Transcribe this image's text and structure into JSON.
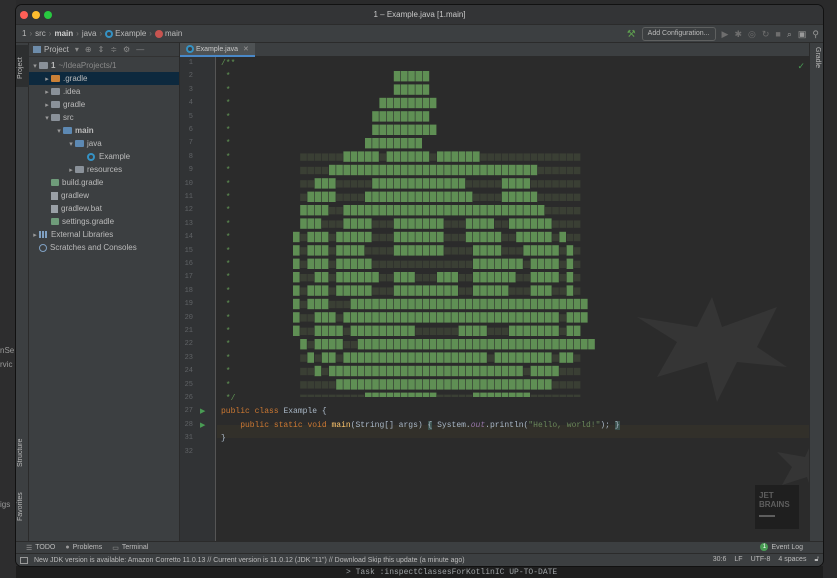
{
  "window": {
    "title": "1 – Example.java [1.main]"
  },
  "navbar": {
    "crumbs": [
      "1",
      "src",
      "main",
      "java",
      "Example",
      "main"
    ],
    "add_configuration": "Add Configuration..."
  },
  "left_strip": {
    "project": "Project",
    "structure": "Structure",
    "favorites": "Favorites"
  },
  "right_strip": {
    "gradle": "Gradle"
  },
  "project_panel": {
    "header": "Project",
    "root_name": "1",
    "root_path": "~/IdeaProjects/1",
    "items": [
      {
        "label": ".gradle",
        "icon": "folder-orange-icon"
      },
      {
        "label": ".idea",
        "icon": "folder-icon"
      },
      {
        "label": "gradle",
        "icon": "folder-icon"
      },
      {
        "label": "src",
        "icon": "folder-icon"
      },
      {
        "label": "main",
        "icon": "folder-blue-icon"
      },
      {
        "label": "java",
        "icon": "folder-blue-icon"
      },
      {
        "label": "Example",
        "icon": "java-class-icon"
      },
      {
        "label": "resources",
        "icon": "resources-folder-icon"
      },
      {
        "label": "build.gradle",
        "icon": "gradle-file-icon"
      },
      {
        "label": "gradlew",
        "icon": "text-file-icon"
      },
      {
        "label": "gradlew.bat",
        "icon": "text-file-icon"
      },
      {
        "label": "settings.gradle",
        "icon": "gradle-file-icon"
      },
      {
        "label": "External Libraries",
        "icon": "library-icon"
      },
      {
        "label": "Scratches and Consoles",
        "icon": "scratch-icon"
      }
    ]
  },
  "editor": {
    "tab": "Example.java",
    "line_numbers": [
      "1",
      "2",
      "3",
      "4",
      "5",
      "6",
      "7",
      "8",
      "9",
      "10",
      "11",
      "12",
      "13",
      "14",
      "15",
      "16",
      "17",
      "18",
      "19",
      "20",
      "21",
      "22",
      "23",
      "24",
      "25",
      "26",
      "27",
      "28",
      "31",
      "32"
    ],
    "code": {
      "l1": "/**",
      "star": " *",
      "l26": " */",
      "kw_public": "public",
      "kw_class": "class",
      "class_name": "Example",
      "open_brace": "{",
      "kw_static": "static",
      "kw_void": "void",
      "method": "main",
      "params": "(String[] args)",
      "sys": "System.",
      "out": "out",
      "println": ".println(",
      "string": "\"Hello, world!\"",
      "end": ");",
      "close_brace": "}"
    },
    "logo_line1": "JET",
    "logo_line2": "BRAINS"
  },
  "bottom_tools": {
    "todo": "TODO",
    "problems": "Problems",
    "terminal": "Terminal",
    "event_log": "Event Log",
    "event_count": "1"
  },
  "status": {
    "message": "New JDK version is available: Amazon Corretto 11.0.13 // Current version is 11.0.12 (JDK \"11\") // Download   Skip this update (a minute ago)",
    "position": "30:6",
    "line_sep": "LF",
    "encoding": "UTF-8",
    "indent": "4 spaces"
  },
  "background": {
    "task": "> Task :inspectClassesForKotlinIC UP-TO-DATE",
    "frag1": "nSe",
    "frag2": "rvic",
    "frag3": "igs"
  },
  "pumpkin": {
    "rows": [
      "..............#####.........................",
      "..............#####.........................",
      "............########........................",
      "...........########.........................",
      "...........#########........................",
      "..........########..........................",
      ".......#####.######.######..................",
      ".....#############################..........",
      "...###.....#############.....####...........",
      "..####....###############....#####..........",
      ".####..############################.........",
      ".###...####...#######...####..######........",
      "#.###.#####...#######...#####..#####.#......",
      "#.###.####....#######....####...#####.#.....",
      "#.###.#####..............#######.####.#.....",
      "#..##.######..###...###..######..####.#.....",
      "#.###.#####...#########..#####...###..#.....",
      "#.###...#################################...",
      "#..###.##############################.###...",
      "#..####.#########......####...#######.##....",
      ".#.####..#################################..",
      "..#.##.####################.########.##.....",
      "...#.###########################.####.......",
      "......##############################........",
      "..........##########.....########..........."
    ]
  }
}
